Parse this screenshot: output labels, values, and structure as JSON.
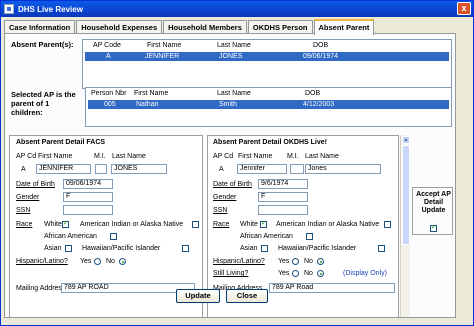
{
  "window": {
    "title": "DHS Live Review",
    "close_label": "x"
  },
  "tabs": [
    "Case Information",
    "Household Expenses",
    "Household Members",
    "OKDHS Person",
    "Absent Parent"
  ],
  "absent_parents": {
    "label": "Absent Parent(s):",
    "headers": [
      "AP Code",
      "First Name",
      "Last Name",
      "DOB"
    ],
    "rows": [
      {
        "code": "A",
        "first": "JENNIFER",
        "last": "JONES",
        "dob": "09/06/1974"
      }
    ]
  },
  "children": {
    "label": "Selected AP is the parent of 1 children:",
    "headers": [
      "Person Nbr",
      "First Name",
      "Last Name",
      "DOB"
    ],
    "rows": [
      {
        "nbr": "005",
        "first": "Nathan",
        "last": "Smith",
        "dob": "4/12/2003"
      }
    ]
  },
  "facs": {
    "title": "Absent Parent Detail FACS",
    "labels": {
      "apcd": "AP Cd",
      "first": "First Name",
      "mi": "M.I.",
      "last": "Last Name",
      "dob": "Date of Birth",
      "gender": "Gender",
      "ssn": "SSN",
      "race": "Race",
      "hispanic": "Hispanic/Latino?",
      "mailing": "Mailing Address"
    },
    "values": {
      "apcd": "A",
      "first": "JENNIFER",
      "mi": "",
      "last": "JONES",
      "dob": "09/06/1974",
      "gender": "F",
      "ssn": "",
      "mailing": "789 AP ROAD"
    },
    "race_opts": [
      "White",
      "American Indian or Alaska Native",
      "African American",
      "Asian",
      "Hawaiian/Pacific Islander"
    ],
    "yes": "Yes",
    "no": "No"
  },
  "okdhs": {
    "title": "Absent Parent Detail OKDHS Live!",
    "labels": {
      "apcd": "AP Cd",
      "first": "First Name",
      "mi": "M.I.",
      "last": "Last Name",
      "dob": "Date of Birth",
      "gender": "Gender",
      "ssn": "SSN",
      "race": "Race",
      "hispanic": "Hispanic/Latino?",
      "still": "Still Living?",
      "mailing": "Mailing Address"
    },
    "values": {
      "apcd": "A",
      "first": "Jennifer",
      "mi": "",
      "last": "Jones",
      "dob": "9/6/1974",
      "gender": "F",
      "ssn": "",
      "mailing": "789 AP Road"
    },
    "race_opts": [
      "White",
      "American Indian or Alaska Native",
      "African American",
      "Asian",
      "Hawaiian/Pacific Islander"
    ],
    "yes": "Yes",
    "no": "No",
    "display_only": "(Display Only)"
  },
  "accept": {
    "label": "Accept AP Detail Update"
  },
  "buttons": {
    "update": "Update",
    "close": "Close"
  }
}
